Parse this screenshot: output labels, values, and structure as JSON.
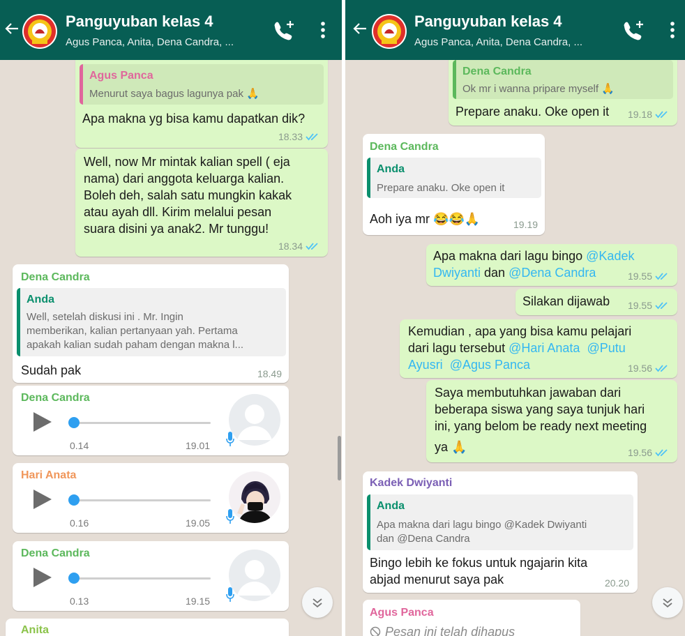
{
  "left": {
    "header": {
      "title": "Panguyuban kelas 4",
      "subtitle": "Agus Panca, Anita, Dena Candra, ..."
    },
    "msg1": {
      "quote_name": "Agus Panca",
      "quote_text": "Menurut saya bagus lagunya pak 🙏",
      "text": "Apa makna yg bisa kamu dapatkan dik?",
      "time": "18.33"
    },
    "msg2": {
      "lines": [
        "Well, now Mr mintak kalian spell ( eja",
        "nama) dari anggota keluarga kalian.",
        "Boleh deh, salah satu mungkin kakak",
        "atau ayah dll. Kirim melalui pesan",
        "suara disini ya anak2. Mr tunggu!"
      ],
      "time": "18.34"
    },
    "msg3": {
      "sender": "Dena Candra",
      "quote_name": "Anda",
      "quote_lines": [
        "Well, setelah diskusi    ini . Mr. Ingin",
        "memberikan,  kalian pertanyaan yah.  Pertama",
        "apakah kalian sudah paham dengan makna l..."
      ],
      "text": "Sudah pak",
      "time": "18.49"
    },
    "voice1": {
      "sender": "Dena Candra",
      "duration": "0.14",
      "time": "19.01"
    },
    "voice2": {
      "sender": "Hari Anata",
      "duration": "0.16",
      "time": "19.05"
    },
    "voice3": {
      "sender": "Dena Candra",
      "duration": "0.13",
      "time": "19.15"
    },
    "next_sender": "Anita"
  },
  "right": {
    "header": {
      "title": "Panguyuban kelas 4",
      "subtitle": "Agus Panca, Anita, Dena Candra, ..."
    },
    "msg1": {
      "quote_name": "Dena Candra",
      "quote_text": "Ok mr i wanna pripare myself 🙏",
      "text": "Prepare anaku. Oke open it",
      "time": "19.18"
    },
    "msg2": {
      "sender": "Dena Candra",
      "quote_name": "Anda",
      "quote_text": "Prepare anaku. Oke open it",
      "text": "Aoh iya mr 😂😂🙏",
      "time": "19.19"
    },
    "msg3": {
      "text_a": "Apa makna dari lagu bingo ",
      "mention_a": "@Kadek",
      "mention_b": "Dwiyanti",
      "text_b": " dan ",
      "mention_c": "@Dena Candra",
      "time": "19.55"
    },
    "msg4": {
      "text": "Silakan dijawab",
      "time": "19.55"
    },
    "msg5": {
      "text_a": "Kemudian , apa yang bisa kamu pelajari",
      "text_b": "dari lagu tersebut ",
      "mention_a": "@Hari Anata",
      "mention_b": "@Putu",
      "mention_c": "Ayusri",
      "mention_d": "@Agus Panca",
      "time": "19.56"
    },
    "msg6": {
      "lines": [
        "Saya membutuhkan jawaban dari",
        "beberapa siswa yang saya tunjuk hari",
        "ini, yang belom be ready next meeting",
        "ya 🙏"
      ],
      "time": "19.56"
    },
    "msg7": {
      "sender": "Kadek Dwiyanti",
      "quote_name": "Anda",
      "quote_lines": [
        "Apa makna dari lagu bingo @Kadek Dwiyanti",
        "dan @Dena Candra"
      ],
      "lines": [
        "Bingo lebih ke fokus untuk ngajarin kita",
        "abjad menurut saya pak"
      ],
      "time": "20.20"
    },
    "msg8": {
      "sender": "Agus Panca",
      "text": "Pesan ini telah dihapus"
    }
  },
  "colors": {
    "header": "#075e54",
    "outgoing": "#dcf8c6",
    "incoming": "#ffffff",
    "chat_bg": "#e5ddd5",
    "read_ticks": "#4fc3f7",
    "mention": "#34b7f1",
    "sender_dena": "#5cb85c",
    "sender_agus": "#e0669c",
    "sender_hari": "#f0965a",
    "sender_kadek": "#7b5fb5",
    "anda": "#0a8f6d"
  },
  "icons": [
    "back-arrow-icon",
    "group-logo-icon",
    "add-call-icon",
    "more-vert-icon",
    "read-ticks-icon",
    "play-icon",
    "mic-icon",
    "scroll-down-icon",
    "deleted-icon"
  ]
}
